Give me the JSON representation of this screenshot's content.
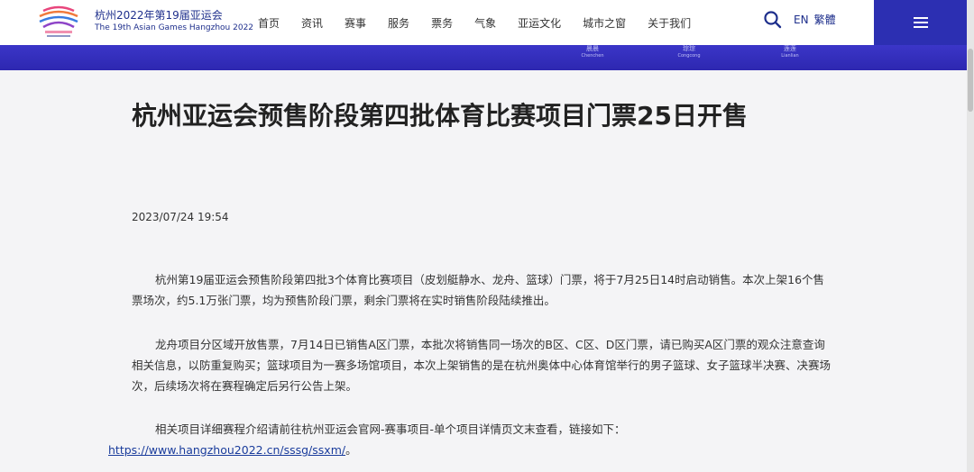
{
  "header": {
    "brand_cn": "杭州2022年第19届亚运会",
    "brand_en": "The 19th Asian Games Hangzhou 2022",
    "logo_text": "19th Asian Games Hangzhou 2022",
    "nav": [
      "首页",
      "资讯",
      "赛事",
      "服务",
      "票务",
      "气象",
      "亚运文化",
      "城市之窗",
      "关于我们"
    ],
    "lang_en": "EN",
    "lang_trad": "繁體",
    "brand_color": "#2c2fb2",
    "search_icon": "search-icon",
    "menu_icon": "hamburger-menu-icon"
  },
  "band": {
    "cities": [
      {
        "cn": "晨晨",
        "en": "Chenchen"
      },
      {
        "cn": "琮琮",
        "en": "Congcong"
      },
      {
        "cn": "莲莲",
        "en": "Lianlian"
      }
    ]
  },
  "article": {
    "title": "杭州亚运会预售阶段第四批体育比赛项目门票25日开售",
    "date": "2023/07/24 19:54",
    "p1": "杭州第19届亚运会预售阶段第四批3个体育比赛项目（皮划艇静水、龙舟、篮球）门票，将于7月25日14时启动销售。本次上架16个售票场次，约5.1万张门票，均为预售阶段门票，剩余门票将在实时销售阶段陆续推出。",
    "p2": "龙舟项目分区域开放售票，7月14日已销售A区门票，本批次将销售同一场次的B区、C区、D区门票，请已购买A区门票的观众注意查询相关信息，以防重复购买；篮球项目为一赛多场馆项目，本次上架销售的是在杭州奥体中心体育馆举行的男子篮球、女子篮球半决赛、决赛场次，后续场次将在赛程确定后另行公告上架。",
    "p3_text": "相关项目详细赛程介绍请前往杭州亚运会官网-赛事项目-单个项目详情页文末查看，链接如下：",
    "p3_link": "https://www.hangzhou2022.cn/sssg/ssxm/",
    "p3_end": "。"
  }
}
